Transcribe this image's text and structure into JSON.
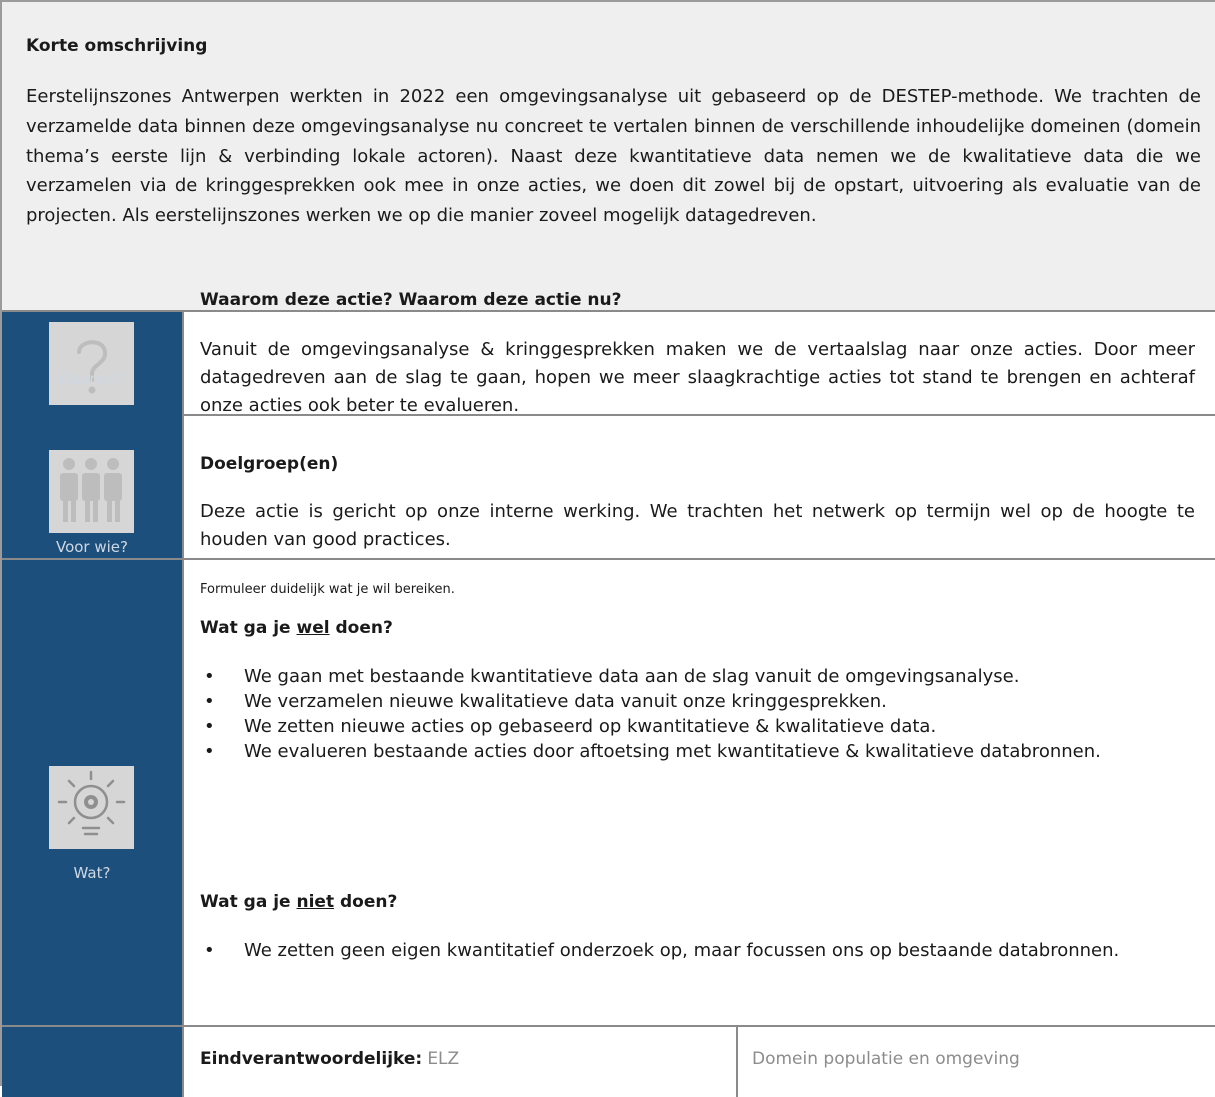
{
  "summary": {
    "title": "Korte omschrijving",
    "text": "Eerstelijnszones Antwerpen werkten in 2022 een omgevingsanalyse uit gebaseerd op de DESTEP-methode. We trachten de verzamelde data binnen deze omgevingsanalyse nu concreet te vertalen binnen de verschillende inhoudelijke domeinen (domein thema’s eerste lijn & verbinding lokale actoren). Naast deze kwantitatieve data nemen we de kwalitatieve data die we verzamelen via de kringgesprekken ook mee in onze acties, we doen dit zowel bij de opstart, uitvoering als evaluatie van de projecten. Als eerstelijnszones werken we op die manier zoveel mogelijk datagedreven."
  },
  "rows": {
    "waarom": {
      "icon": "question-icon",
      "label": "Waarom?",
      "heading": "Waarom deze actie? Waarom deze actie nu?",
      "text": "Vanuit de omgevingsanalyse & kringgesprekken maken we de vertaalslag naar onze acties. Door meer datagedreven aan de slag te gaan, hopen we meer slaagkrachtige acties tot stand te brengen en achteraf onze acties ook beter te evalueren."
    },
    "voor_wie": {
      "icon": "people-icon",
      "label": "Voor wie?",
      "heading": "Doelgroep(en)",
      "text": "Deze actie is gericht op onze interne werking. We trachten het netwerk op termijn wel op de hoogte te houden van good practices."
    },
    "wat": {
      "icon": "lightbulb-gear-icon",
      "label": "Wat?",
      "hint": "Formuleer duidelijk wat je wil bereiken.",
      "wel_heading_prefix": "Wat ga je ",
      "wel_heading_underlined": "wel",
      "wel_heading_suffix": " doen?",
      "wel_items": [
        "We gaan met bestaande kwantitatieve data aan de slag vanuit de omgevingsanalyse.",
        "We verzamelen nieuwe kwalitatieve data vanuit onze kringgesprekken.",
        "We zetten nieuwe acties op gebaseerd op kwantitatieve & kwalitatieve data.",
        "We evalueren bestaande acties door aftoetsing met kwantitatieve & kwalitatieve databronnen."
      ],
      "niet_heading_prefix": "Wat ga je ",
      "niet_heading_underlined": "niet",
      "niet_heading_suffix": " doen?",
      "niet_items": [
        "We zetten geen eigen kwantitatief onderzoek op, maar focussen ons op bestaande databronnen."
      ],
      "bullet": "•"
    },
    "last": {
      "label_bold": "Eindverantwoordelijke:",
      "value": "ELZ",
      "domain": "Domein populatie en omgeving"
    }
  }
}
